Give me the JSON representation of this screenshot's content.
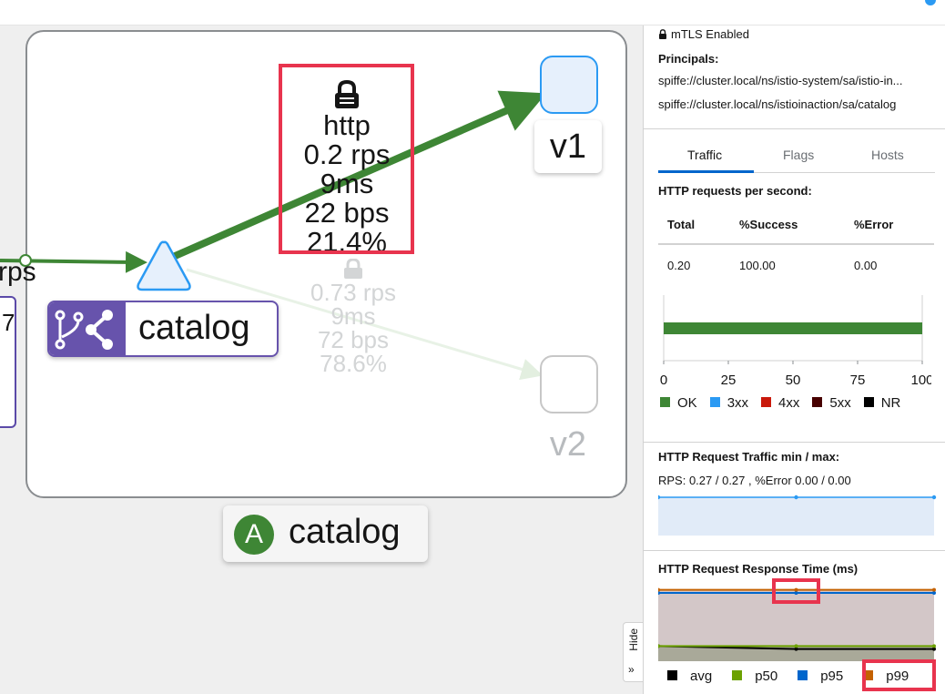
{
  "graph": {
    "left_fragment": "7",
    "rps_fragment": "rps",
    "service_name": "catalog",
    "namespace_badge": "A",
    "namespace_name": "catalog",
    "main_edge": {
      "lock_icon": "lock-icon",
      "protocol": "http",
      "rps": "0.2 rps",
      "latency": "9ms",
      "throughput": "22 bps",
      "percent": "21.4%"
    },
    "faded_edge": {
      "lock_icon": "lock-icon",
      "rps": "0.73 rps",
      "latency": "9ms",
      "throughput": "72 bps",
      "percent": "78.6%"
    },
    "versions": {
      "v1": "v1",
      "v2": "v2"
    },
    "hide_tab": {
      "label": "Hide",
      "icon": "double-chevron-right-icon"
    },
    "colors": {
      "edge_green": "#3e8635",
      "faded_green": "#e8f2e6",
      "service_purple": "#6753ac",
      "highlight_red": "#e8344e"
    }
  },
  "panel": {
    "mtls_label": "mTLS Enabled",
    "principals_label": "Principals:",
    "principals": [
      "spiffe://cluster.local/ns/istio-system/sa/istio-in...",
      "spiffe://cluster.local/ns/istioinaction/sa/catalog"
    ],
    "tabs": [
      {
        "label": "Traffic",
        "active": true
      },
      {
        "label": "Flags",
        "active": false
      },
      {
        "label": "Hosts",
        "active": false
      }
    ],
    "http_rps_title": "HTTP requests per second:",
    "table": {
      "headers": [
        "Total",
        "%Success",
        "%Error"
      ],
      "values": [
        "0.20",
        "100.00",
        "0.00"
      ]
    },
    "traffic_min_max_title": "HTTP Request Traffic min / max:",
    "traffic_min_max_value": "RPS: 0.27 / 0.27 , %Error 0.00 / 0.00",
    "response_time_title": "HTTP Request Response Time (ms)"
  },
  "chart_data": [
    {
      "type": "bar",
      "orientation": "horizontal",
      "categories": [
        ""
      ],
      "series": [
        {
          "name": "OK",
          "values": [
            100
          ],
          "color": "#3e8635"
        },
        {
          "name": "3xx",
          "values": [
            0
          ],
          "color": "#2b9af3"
        },
        {
          "name": "4xx",
          "values": [
            0
          ],
          "color": "#c9190b"
        },
        {
          "name": "5xx",
          "values": [
            0
          ],
          "color": "#470000"
        },
        {
          "name": "NR",
          "values": [
            0
          ],
          "color": "#000000"
        }
      ],
      "x_ticks": [
        "0",
        "25",
        "50",
        "75",
        "100"
      ],
      "xlim": [
        0,
        100
      ],
      "legend": "bottom"
    },
    {
      "type": "area",
      "series": [
        {
          "values": [
            0.27,
            0.27,
            0.27
          ],
          "color": "#2b9af3"
        }
      ],
      "legend": "none"
    },
    {
      "type": "area",
      "series": [
        {
          "name": "avg",
          "values": [
            10,
            9.2,
            9.2
          ],
          "color": "#000000"
        },
        {
          "name": "p50",
          "values": [
            10,
            10,
            10
          ],
          "color": "#6ca100"
        },
        {
          "name": "p95",
          "values": [
            24,
            24,
            24
          ],
          "color": "#0066cc"
        },
        {
          "name": "p99",
          "values": [
            24.8,
            24.8,
            24.8
          ],
          "color": "#c46100"
        }
      ],
      "legend": "bottom"
    }
  ]
}
